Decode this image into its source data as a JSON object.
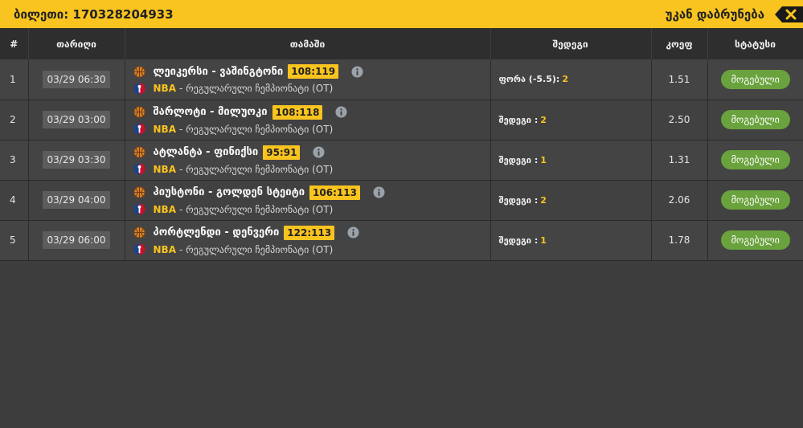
{
  "header": {
    "ticket_label": "ბილეთი: 170328204933",
    "back_label": "უკან დაბრუნება"
  },
  "table": {
    "columns": [
      "#",
      "თარიღი",
      "თამაში",
      "შედეგი",
      "კოეფ",
      "სტატუსი"
    ],
    "rows": [
      {
        "num": "1",
        "date": "03/29 06:30",
        "teams": "ლეიკერსი - ვაშინგტონი",
        "score": "108:119",
        "league": "NBA",
        "league_rest": "- რეგულარული ჩემპიონატი (OT)",
        "result_label": "ფორა (-5.5):",
        "result_value": "2",
        "odd": "1.51",
        "status": "მოგებული"
      },
      {
        "num": "2",
        "date": "03/29 03:00",
        "teams": "შარლოტი - მილუოკი",
        "score": "108:118",
        "league": "NBA",
        "league_rest": "- რეგულარული ჩემპიონატი (OT)",
        "result_label": "შედეგი :",
        "result_value": "2",
        "odd": "2.50",
        "status": "მოგებული"
      },
      {
        "num": "3",
        "date": "03/29 03:30",
        "teams": "ატლანტა - ფინიქსი",
        "score": "95:91",
        "league": "NBA",
        "league_rest": "- რეგულარული ჩემპიონატი (OT)",
        "result_label": "შედეგი :",
        "result_value": "1",
        "odd": "1.31",
        "status": "მოგებული"
      },
      {
        "num": "4",
        "date": "03/29 04:00",
        "teams": "ჰიუსტონი - გოლდენ სტეიტი",
        "score": "106:113",
        "league": "NBA",
        "league_rest": "- რეგულარული ჩემპიონატი (OT)",
        "result_label": "შედეგი :",
        "result_value": "2",
        "odd": "2.06",
        "status": "მოგებული"
      },
      {
        "num": "5",
        "date": "03/29 06:00",
        "teams": "პორტლენდი - დენვერი",
        "score": "122:113",
        "league": "NBA",
        "league_rest": "- რეგულარული ჩემპიონატი (OT)",
        "result_label": "შედეგი :",
        "result_value": "1",
        "odd": "1.78",
        "status": "მოგებული"
      }
    ]
  },
  "icons": {
    "sport": "basketball-icon",
    "league": "nba-logo-icon",
    "info": "info-icon",
    "back": "backspace-close-icon"
  },
  "colors": {
    "accent": "#f9c41f",
    "won": "#6aa23d",
    "background": "#3d3d3d",
    "header_row": "#2e2e2e"
  }
}
